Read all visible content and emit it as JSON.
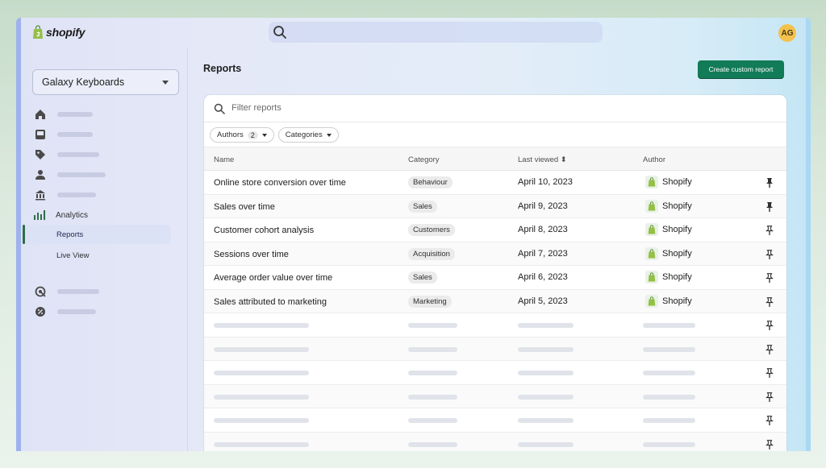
{
  "app": {
    "brand": "shopify",
    "avatar_initials": "AG"
  },
  "topbar": {
    "search_icon": "search-icon"
  },
  "sidebar": {
    "store_name": "Galaxy Keyboards",
    "nav": [
      {
        "icon": "home-icon"
      },
      {
        "icon": "inbox-icon"
      },
      {
        "icon": "tag-icon"
      },
      {
        "icon": "person-icon"
      },
      {
        "icon": "bank-icon"
      }
    ],
    "analytics_label": "Analytics",
    "reports_label": "Reports",
    "live_view_label": "Live View",
    "extra": [
      {
        "icon": "target-icon"
      },
      {
        "icon": "discount-icon"
      }
    ]
  },
  "main": {
    "title": "Reports",
    "create_button": "Create custom report",
    "filter_placeholder": "Filter reports",
    "chips": {
      "authors_label": "Authors",
      "authors_count": "2",
      "categories_label": "Categories"
    },
    "columns": {
      "name": "Name",
      "category": "Category",
      "last_viewed": "Last viewed ⬍",
      "author": "Author"
    },
    "rows": [
      {
        "name": "Online store conversion over time",
        "category": "Behaviour",
        "date": "April 10, 2023",
        "author": "Shopify",
        "pinned": true
      },
      {
        "name": "Sales over time",
        "category": "Sales",
        "date": "April 9, 2023",
        "author": "Shopify",
        "pinned": true
      },
      {
        "name": "Customer cohort analysis",
        "category": "Customers",
        "date": "April 8, 2023",
        "author": "Shopify",
        "pinned": false
      },
      {
        "name": "Sessions over time",
        "category": "Acquisition",
        "date": "April 7, 2023",
        "author": "Shopify",
        "pinned": false
      },
      {
        "name": "Average order value over time",
        "category": "Sales",
        "date": "April 6, 2023",
        "author": "Shopify",
        "pinned": false
      },
      {
        "name": "Sales attributed to marketing",
        "category": "Marketing",
        "date": "April 5, 2023",
        "author": "Shopify",
        "pinned": false
      }
    ],
    "placeholder_rows": 6
  },
  "colors": {
    "primary_button": "#127b57",
    "accent_green": "#2c6e49",
    "avatar": "#f2c14e"
  }
}
